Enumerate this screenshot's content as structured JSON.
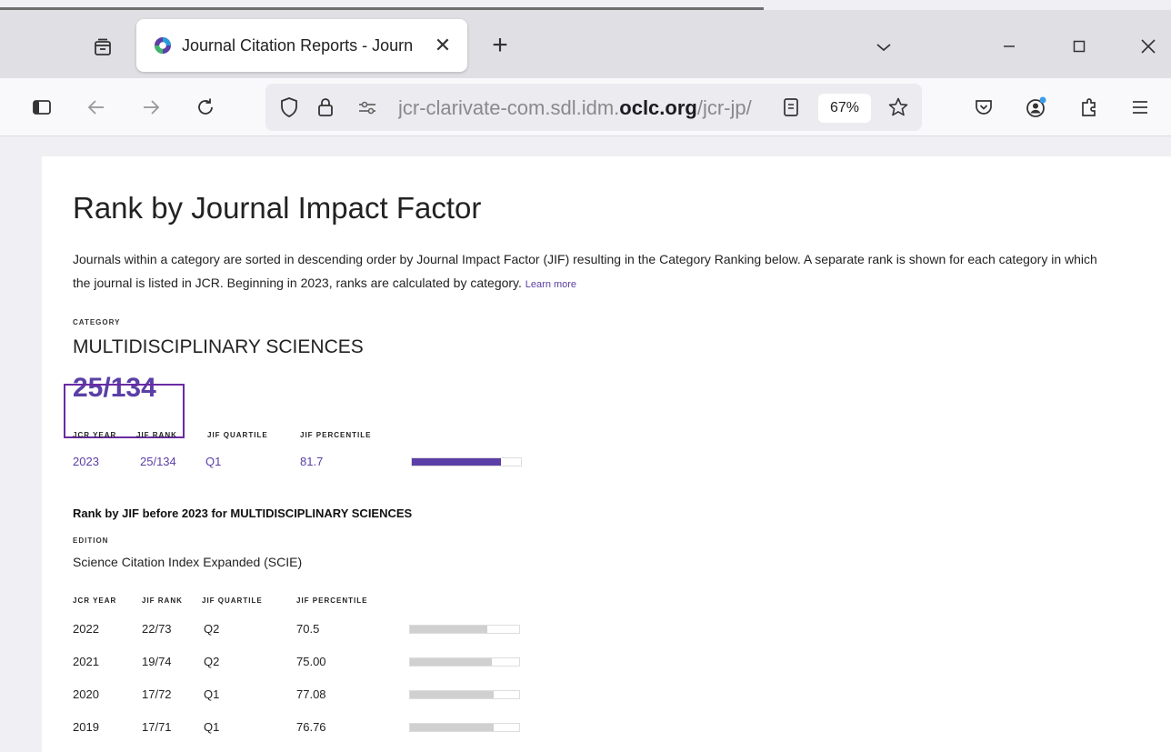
{
  "browser": {
    "tab_title": "Journal Citation Reports - Journ",
    "url_plain": "jcr-clarivate-com.sdl.idm.",
    "url_bold": "oclc.org",
    "url_path": "/jcr-jp/",
    "zoom": "67%"
  },
  "page": {
    "title": "Rank by Journal Impact Factor",
    "description": "Journals within a category are sorted in descending order by Journal Impact Factor (JIF) resulting in the Category Ranking below. A separate rank is shown for each category in which the journal is listed in JCR. Beginning in 2023, ranks are calculated by category.",
    "learn_more": "Learn more",
    "category_label": "CATEGORY",
    "category": "MULTIDISCIPLINARY SCIENCES",
    "rank": "25/134",
    "headers": {
      "year": "JCR YEAR",
      "rank": "JIF RANK",
      "quartile": "JIF QUARTILE",
      "percentile": "JIF PERCENTILE"
    },
    "current": {
      "year": "2023",
      "rank": "25/134",
      "quartile": "Q1",
      "percentile": "81.7",
      "percentile_value": 81.7
    },
    "history_title": "Rank by JIF before 2023 for MULTIDISCIPLINARY SCIENCES",
    "edition_label": "EDITION",
    "edition": "Science Citation Index Expanded (SCIE)",
    "history": [
      {
        "year": "2022",
        "rank": "22/73",
        "quartile": "Q2",
        "percentile": "70.5",
        "percentile_value": 70.5
      },
      {
        "year": "2021",
        "rank": "19/74",
        "quartile": "Q2",
        "percentile": "75.00",
        "percentile_value": 75.0
      },
      {
        "year": "2020",
        "rank": "17/72",
        "quartile": "Q1",
        "percentile": "77.08",
        "percentile_value": 77.08
      },
      {
        "year": "2019",
        "rank": "17/71",
        "quartile": "Q1",
        "percentile": "76.76",
        "percentile_value": 76.76
      }
    ]
  },
  "colors": {
    "accent": "#5b3fa6",
    "bar_gray": "#d0d0d0",
    "highlight": "#6a2aa3"
  }
}
